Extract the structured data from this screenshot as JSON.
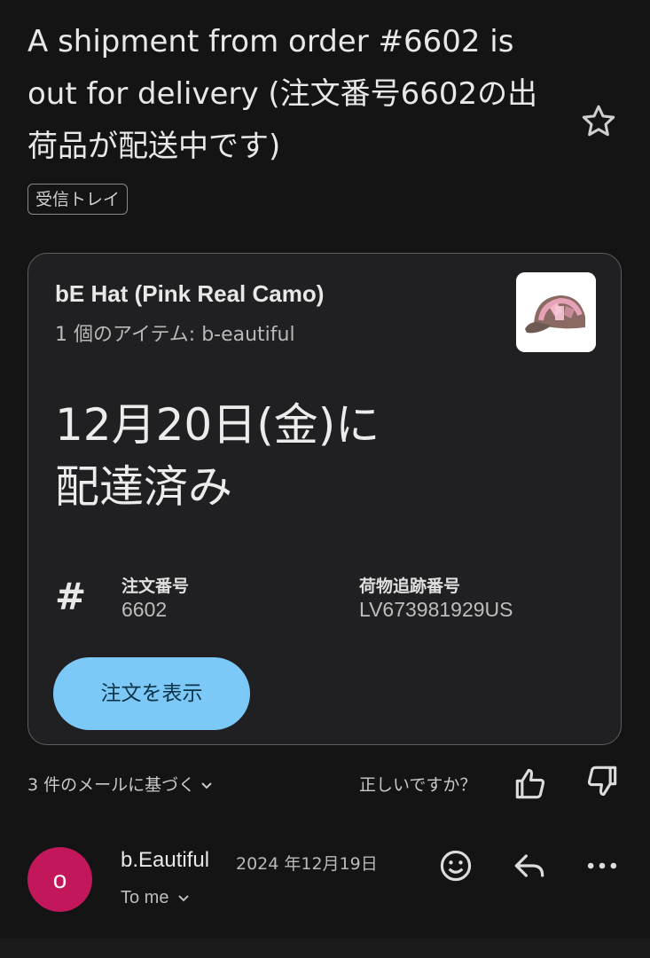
{
  "subject": "A shipment from order #6602 is out for delivery (注文番号6602の出荷品が配送中です)",
  "label": "受信トレイ",
  "card": {
    "product_name": "bE Hat (Pink Real Camo)",
    "product_sub": "1 個のアイテム: b-eautiful",
    "delivery_line1": "12月20日(金)に",
    "delivery_line2": "配達済み",
    "order_label": "注文番号",
    "order_value": "6602",
    "tracking_label": "荷物追跡番号",
    "tracking_value": "LV673981929US",
    "view_button": "注文を表示"
  },
  "feedback": {
    "based_on": "3 件のメールに基づく",
    "question": "正しいですか？"
  },
  "message": {
    "avatar_letter": "o",
    "sender": "b.Eautiful",
    "date": "2024 年12月19日",
    "to": "To me"
  },
  "colors": {
    "background": "#141414",
    "card": "#202022",
    "button": "#7cc9f7",
    "avatar": "#c2185b"
  },
  "icons": [
    "star-icon",
    "hash-icon",
    "chevron-down-icon",
    "thumbs-up-icon",
    "thumbs-down-icon",
    "emoji-icon",
    "reply-icon",
    "more-icon"
  ]
}
